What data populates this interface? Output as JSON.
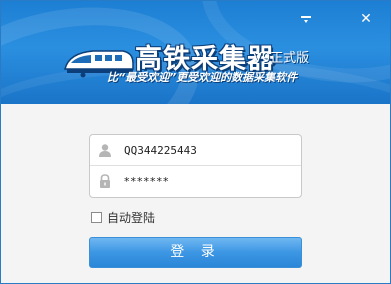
{
  "window": {
    "minimize_icon": "minimize-icon",
    "close_label": "✕"
  },
  "banner": {
    "title": "高铁采集器",
    "version": "V9正式版",
    "slogan": "比“最受欢迎”更受欢迎的数据采集软件",
    "logo": "bullet-train-icon",
    "colors": {
      "banner": "#1f80d4",
      "text_shadow": "#0c3f7a"
    }
  },
  "login": {
    "account_value": "QQ344225443",
    "account_icon": "user-icon",
    "password_value": "*******",
    "password_icon": "lock-icon",
    "auto_login_label": "自动登陆",
    "auto_login_checked": false,
    "login_button_label": "登 录",
    "colors": {
      "button": "#3c96e3"
    }
  }
}
